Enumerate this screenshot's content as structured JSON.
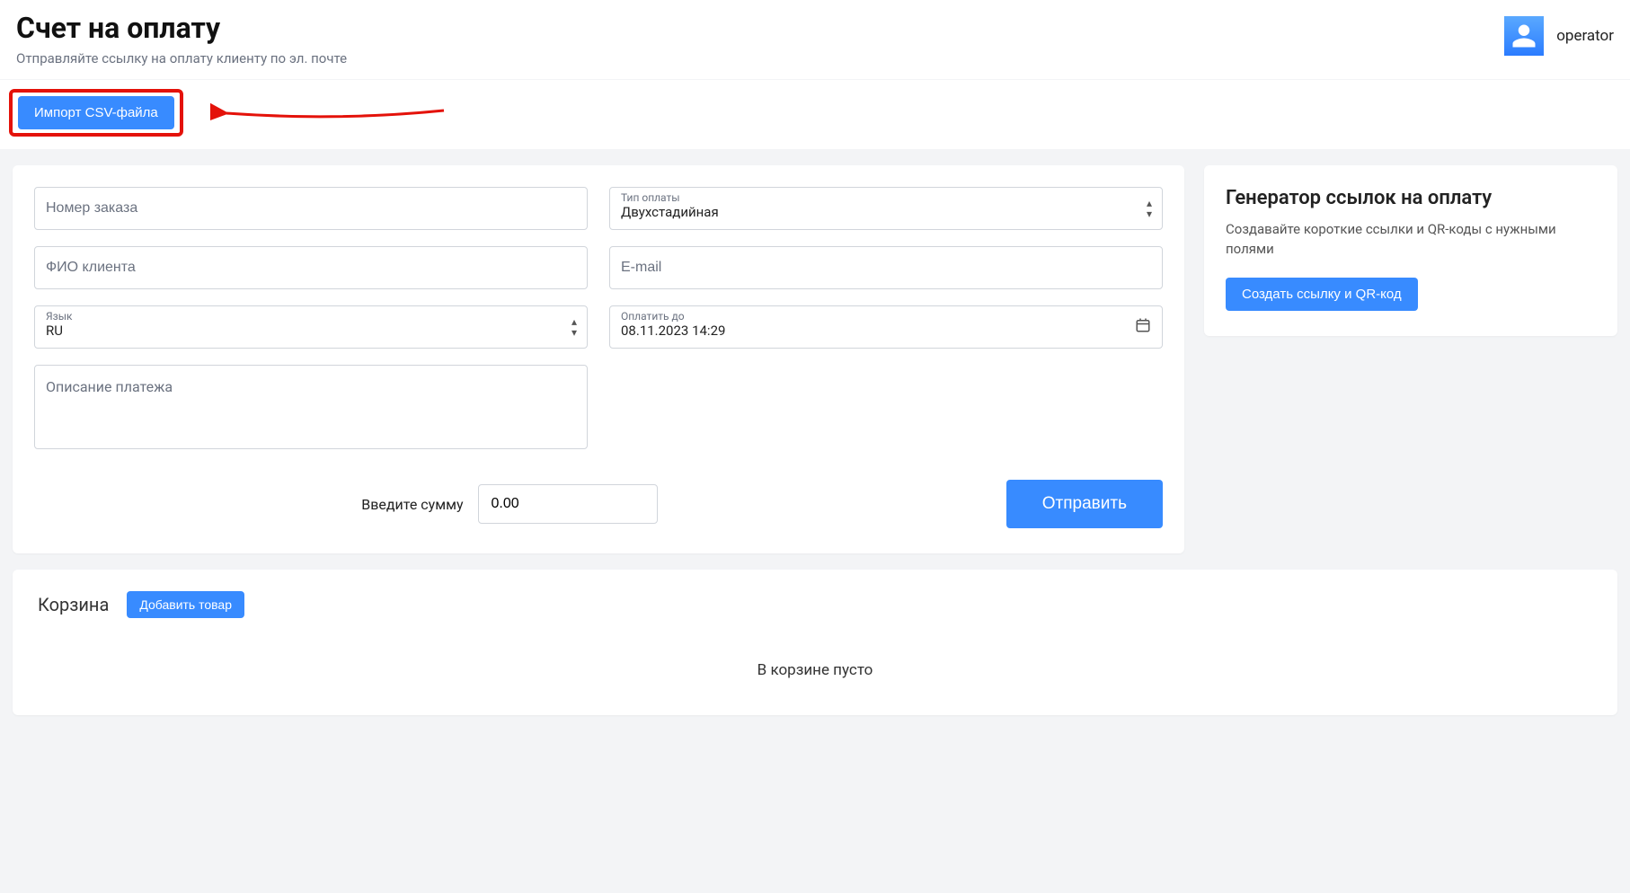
{
  "header": {
    "title": "Счет на оплату",
    "subtitle": "Отправляйте ссылку на оплату клиенту по эл. почте",
    "username": "operator"
  },
  "toolbar": {
    "import_button": "Импорт CSV-файла"
  },
  "form": {
    "order_number_placeholder": "Номер заказа",
    "payment_type": {
      "label": "Тип оплаты",
      "value": "Двухстадийная"
    },
    "client_name_placeholder": "ФИО клиента",
    "email_placeholder": "E-mail",
    "language": {
      "label": "Язык",
      "value": "RU"
    },
    "pay_until": {
      "label": "Оплатить до",
      "value": "08.11.2023 14:29"
    },
    "description_placeholder": "Описание платежа",
    "amount_label": "Введите сумму",
    "amount_value": "0.00",
    "send_button": "Отправить"
  },
  "side": {
    "title": "Генератор ссылок на оплату",
    "text": "Создавайте короткие ссылки и QR-коды с нужными полями",
    "button": "Создать ссылку и QR-код"
  },
  "basket": {
    "title": "Корзина",
    "add_button": "Добавить товар",
    "empty_text": "В корзине пусто"
  }
}
